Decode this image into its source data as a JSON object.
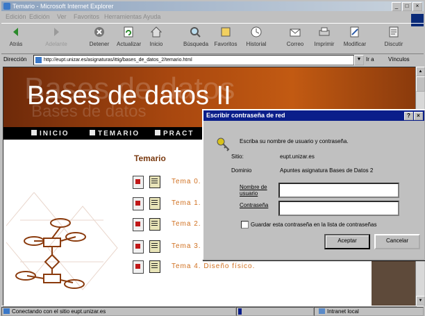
{
  "window": {
    "title": "Temario - Microsoft Internet Explorer",
    "controls": [
      "_",
      "□",
      "×"
    ]
  },
  "menu": [
    "Edición",
    "Edición",
    "Ver",
    "Favoritos",
    "Herramientas",
    "Ayuda"
  ],
  "toolbar": [
    {
      "label": "Atrás",
      "icon": "back-arrow-icon"
    },
    {
      "label": "Adelante",
      "icon": "forward-arrow-icon"
    },
    {
      "label": "Detener",
      "icon": "stop-icon"
    },
    {
      "label": "Actualizar",
      "icon": "refresh-icon"
    },
    {
      "label": "Inicio",
      "icon": "home-icon"
    },
    {
      "label": "Búsqueda",
      "icon": "search-icon"
    },
    {
      "label": "Favoritos",
      "icon": "favorites-icon"
    },
    {
      "label": "Historial",
      "icon": "history-icon"
    },
    {
      "label": "Correo",
      "icon": "mail-icon"
    },
    {
      "label": "Imprimir",
      "icon": "print-icon"
    },
    {
      "label": "Modificar",
      "icon": "edit-icon"
    },
    {
      "label": "Discutir",
      "icon": "discuss-icon"
    }
  ],
  "address": {
    "label": "Dirección",
    "url": "http://eupt.unizar.es/asignaturas/ittig/bases_de_datos_2/temario.html",
    "go_label": "Ir a",
    "links_label": "Vínculos"
  },
  "page": {
    "banner_title": "Bases de datos II",
    "banner_ghost": "Bases de datos",
    "nav": [
      "INICIO",
      "TEMARIO",
      "PRACT"
    ],
    "temario_heading": "Temario",
    "topics": [
      {
        "label": "Tema 0."
      },
      {
        "label": "Tema 1."
      },
      {
        "label": "Tema 2."
      },
      {
        "label": "Tema 3."
      },
      {
        "label": "Tema 4.  Diseño físico."
      }
    ]
  },
  "dialog": {
    "title": "Escribir contraseña de red",
    "prompt": "Escriba su nombre de usuario y contraseña.",
    "site_label": "Sitio:",
    "site_value": "eupt.unizar.es",
    "domain_label": "Dominio",
    "domain_value": "Apuntes asignatura Bases de Datos 2",
    "username_label": "Nombre de usuario",
    "username_value": "",
    "password_label": "Contraseña",
    "password_value": "",
    "save_label": "Guardar esta contraseña en la lista de contraseñas",
    "save_checked": false,
    "ok_label": "Aceptar",
    "cancel_label": "Cancelar",
    "help_label": "?",
    "close_label": "×"
  },
  "status": {
    "text": "Conectando con el sitio eupt.unizar.es",
    "zone": "Intranet local"
  },
  "colors": {
    "title_active": "#0a1e8a",
    "banner": "#a8470f",
    "link": "#d07020"
  }
}
